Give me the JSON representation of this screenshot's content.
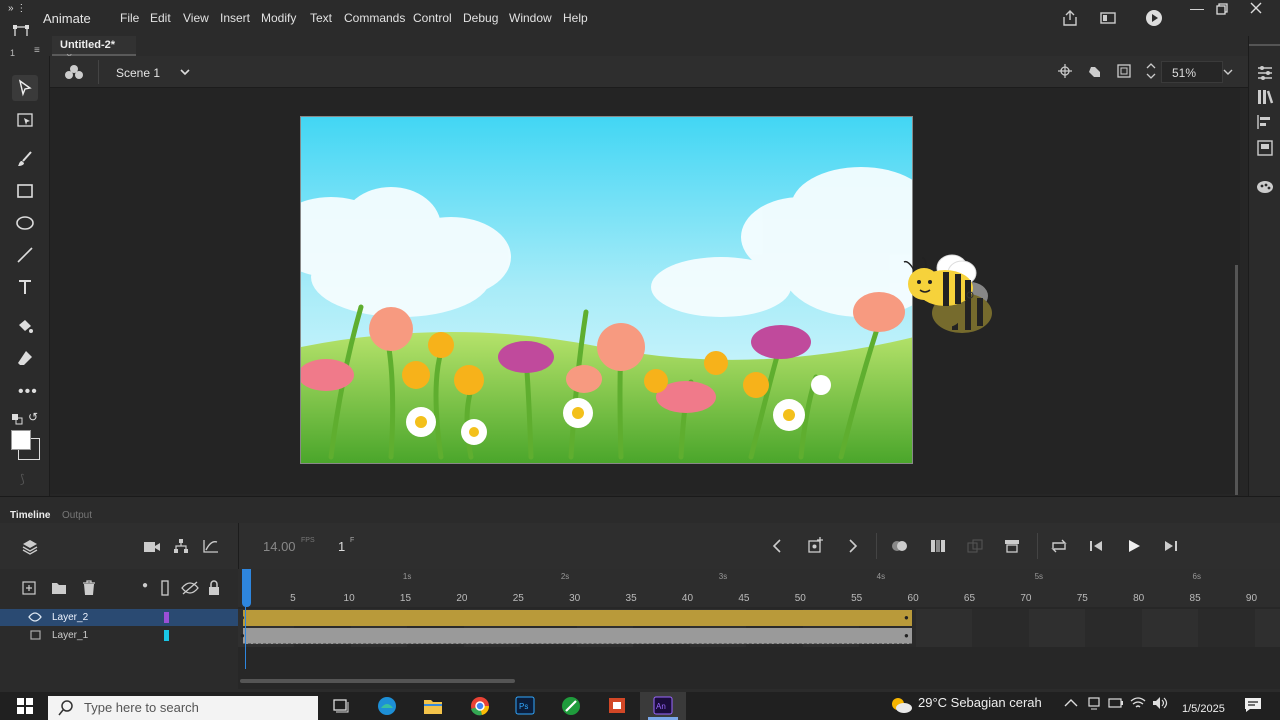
{
  "app": {
    "name": "Animate",
    "menu": [
      "File",
      "Edit",
      "View",
      "Insert",
      "Modify",
      "Text",
      "Commands",
      "Control",
      "Debug",
      "Window",
      "Help"
    ]
  },
  "document": {
    "tab_label": "Untitled-2*",
    "close_glyph": "×"
  },
  "scenebar": {
    "scene_label": "Scene 1",
    "zoom": "51%"
  },
  "timeline": {
    "tabs": [
      "Timeline",
      "Output"
    ],
    "fps": "14.00",
    "fps_unit": "FPS",
    "frame": "1",
    "frame_unit": "F",
    "ruler_numbers": [
      "5",
      "10",
      "15",
      "20",
      "25",
      "30",
      "35",
      "40",
      "45",
      "50",
      "55",
      "60",
      "65",
      "70",
      "75",
      "80",
      "85",
      "90"
    ],
    "ruler_seconds": [
      "1s",
      "2s",
      "3s",
      "4s",
      "5s",
      "6s"
    ],
    "layers": [
      {
        "name": "Layer_2",
        "color": "#9b4fd6",
        "selected": true
      },
      {
        "name": "Layer_1",
        "color": "#19c6e6",
        "selected": false
      }
    ]
  },
  "taskbar": {
    "search_placeholder": "Type here to search",
    "weather": "29°C  Sebagian cerah",
    "date": "1/5/2025"
  },
  "colors": {
    "accent": "#2e86de",
    "span_layer2": "#b99a3a",
    "span_layer1": "#9a9a9a",
    "selected_row": "#2a4a72"
  }
}
